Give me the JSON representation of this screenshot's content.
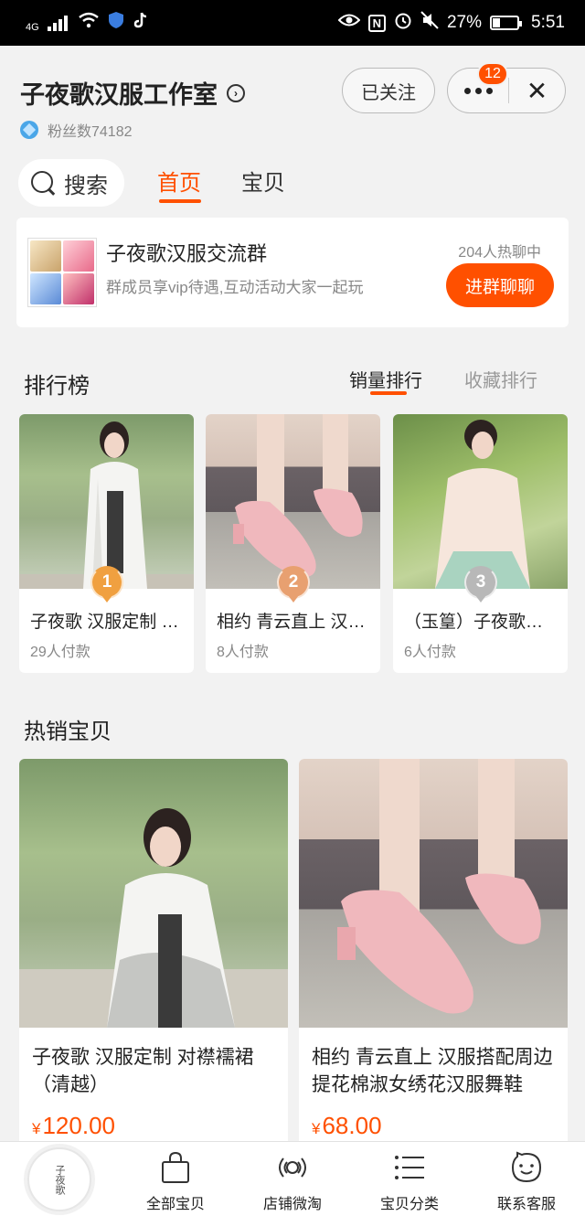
{
  "status_bar": {
    "signal_label": "4G",
    "battery": "27%",
    "time": "5:51",
    "app_letter": "N"
  },
  "header": {
    "shop_name": "子夜歌汉服工作室",
    "fans": "粉丝数74182",
    "follow_label": "已关注",
    "badge_count": "12",
    "close_glyph": "✕"
  },
  "nav_tabs": {
    "search_label": "搜索",
    "home": "首页",
    "items": "宝贝"
  },
  "group": {
    "title": "子夜歌汉服交流群",
    "subtitle": "群成员享vip待遇,互动活动大家一起玩",
    "hot_count": "204人热聊中",
    "join_label": "进群聊聊"
  },
  "ranking": {
    "title": "排行榜",
    "tabs": [
      "销量排行",
      "收藏排行"
    ],
    "items": [
      {
        "rank": "1",
        "name": "子夜歌 汉服定制 对襟襦裙",
        "sold": "29人付款",
        "medal_color": "#f0a040"
      },
      {
        "rank": "2",
        "name": "相约 青云直上 汉服搭配周边",
        "sold": "8人付款",
        "medal_color": "#e8a070"
      },
      {
        "rank": "3",
        "name": "（玉篁）子夜歌汉服",
        "sold": "6人付款",
        "medal_color": "#b8b8b8"
      }
    ]
  },
  "hot": {
    "title": "热销宝贝",
    "items": [
      {
        "name": "子夜歌 汉服定制 对襟襦裙（清越）",
        "currency": "¥",
        "price": "120.00"
      },
      {
        "name": "相约 青云直上 汉服搭配周边提花棉淑女绣花汉服舞鞋",
        "currency": "¥",
        "price": "68.00"
      }
    ]
  },
  "bottom_nav": {
    "logo_text": "子夜歌",
    "items": [
      "全部宝贝",
      "店铺微淘",
      "宝贝分类",
      "联系客服"
    ]
  },
  "colors": {
    "accent": "#ff5000",
    "background": "#f2f2f2"
  }
}
